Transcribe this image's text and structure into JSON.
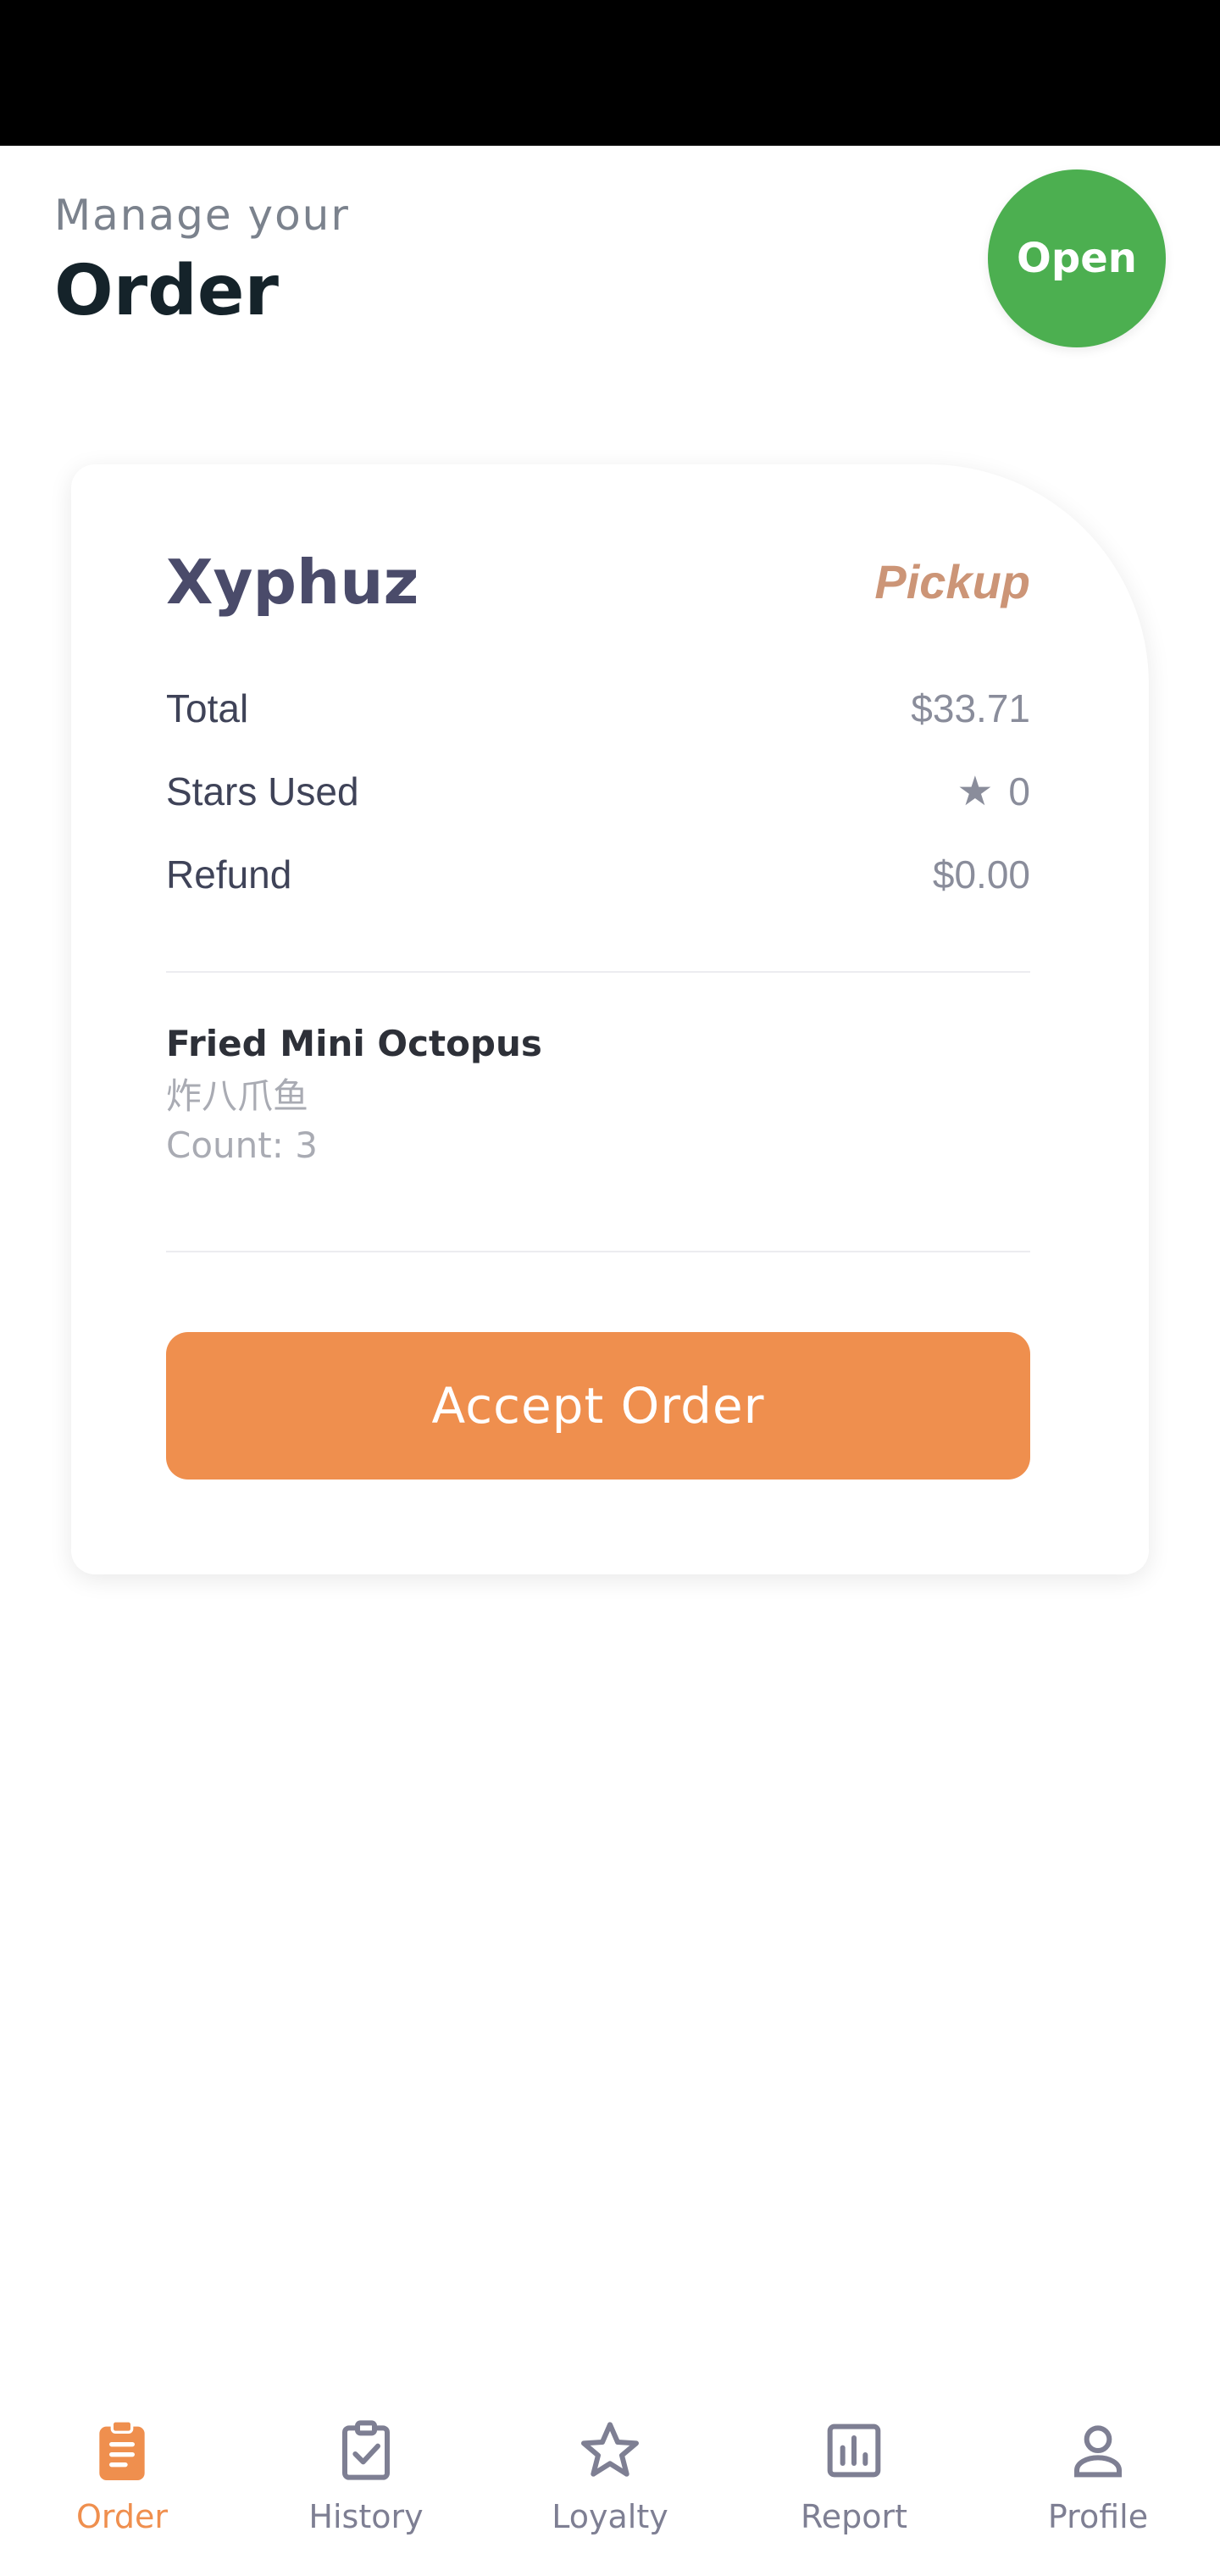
{
  "header": {
    "subtitle": "Manage your",
    "title": "Order",
    "status_button": "Open"
  },
  "order": {
    "customer": "Xyphuz",
    "type": "Pickup",
    "summary": [
      {
        "label": "Total",
        "value": "$33.71"
      },
      {
        "label": "Stars Used",
        "value": "0",
        "icon": "star-icon"
      },
      {
        "label": "Refund",
        "value": "$0.00"
      }
    ],
    "items": [
      {
        "name": "Fried Mini Octopus",
        "subname": "炸八爪鱼",
        "count": "Count: 3"
      }
    ],
    "accept_label": "Accept Order"
  },
  "nav": {
    "items": [
      {
        "label": "Order",
        "icon": "clipboard-icon",
        "active": true
      },
      {
        "label": "History",
        "icon": "clipboard-check-icon",
        "active": false
      },
      {
        "label": "Loyalty",
        "icon": "star-icon",
        "active": false
      },
      {
        "label": "Report",
        "icon": "bar-chart-icon",
        "active": false
      },
      {
        "label": "Profile",
        "icon": "person-icon",
        "active": false
      }
    ]
  },
  "colors": {
    "accent": "#ef8f4e",
    "open_green": "#4caf50",
    "pickup": "#cc9577",
    "nav_inactive": "#7e7f93"
  }
}
